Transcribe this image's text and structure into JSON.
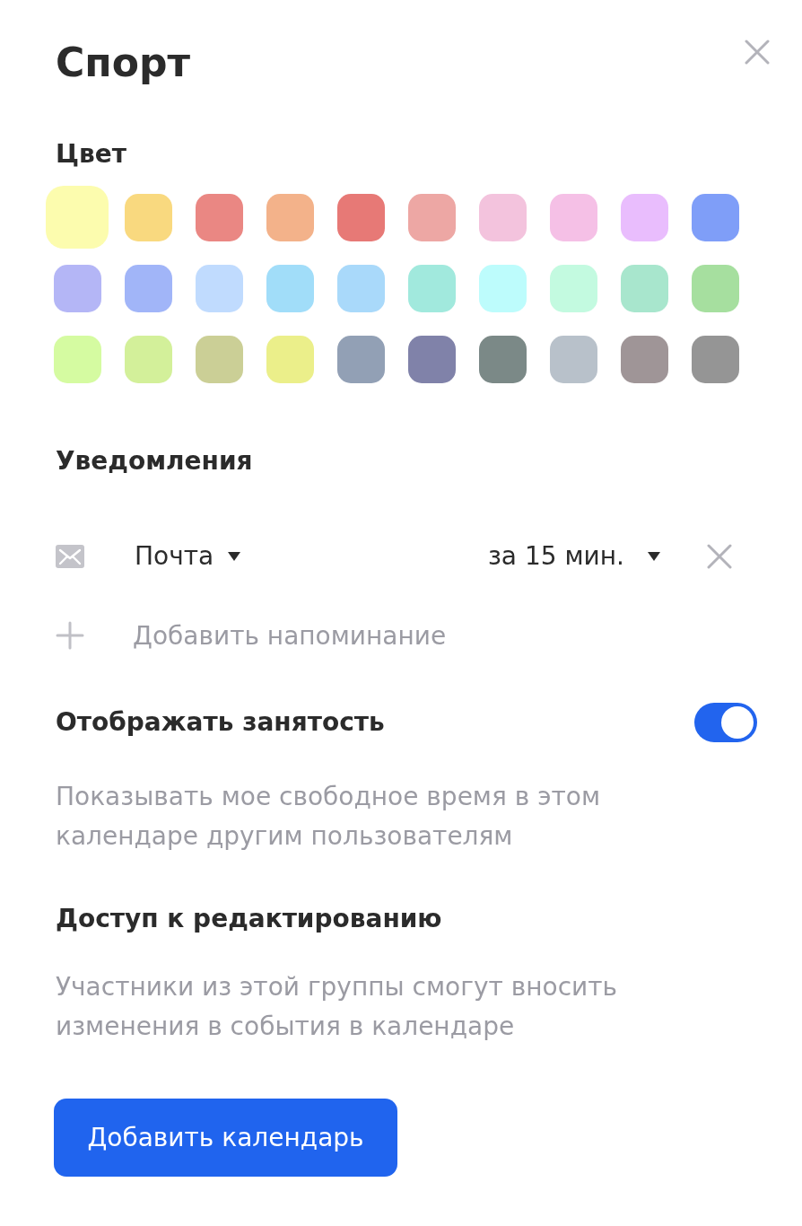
{
  "title": "Спорт",
  "colors": {
    "heading": "Цвет",
    "swatches": [
      {
        "color": "#fcfcae",
        "selected": true
      },
      {
        "color": "#f9d97f",
        "selected": false
      },
      {
        "color": "#ea8783",
        "selected": false
      },
      {
        "color": "#f3b28a",
        "selected": false
      },
      {
        "color": "#e77976",
        "selected": false
      },
      {
        "color": "#eda7a4",
        "selected": false
      },
      {
        "color": "#f3c3dd",
        "selected": false
      },
      {
        "color": "#f5c0e6",
        "selected": false
      },
      {
        "color": "#e9bdfd",
        "selected": false
      },
      {
        "color": "#7f9ef8",
        "selected": false
      },
      {
        "color": "#b4b6f6",
        "selected": false
      },
      {
        "color": "#a1b5f8",
        "selected": false
      },
      {
        "color": "#c0dbfe",
        "selected": false
      },
      {
        "color": "#a1ddf9",
        "selected": false
      },
      {
        "color": "#a9d9fa",
        "selected": false
      },
      {
        "color": "#a1e9dd",
        "selected": false
      },
      {
        "color": "#bdfcfc",
        "selected": false
      },
      {
        "color": "#c3fae0",
        "selected": false
      },
      {
        "color": "#a8e6cd",
        "selected": false
      },
      {
        "color": "#a6df9f",
        "selected": false
      },
      {
        "color": "#d5fba1",
        "selected": false
      },
      {
        "color": "#d3f09a",
        "selected": false
      },
      {
        "color": "#cbcf96",
        "selected": false
      },
      {
        "color": "#ebef8a",
        "selected": false
      },
      {
        "color": "#92a0b5",
        "selected": false
      },
      {
        "color": "#8082a9",
        "selected": false
      },
      {
        "color": "#7b8987",
        "selected": false
      },
      {
        "color": "#b8c1ca",
        "selected": false
      },
      {
        "color": "#9f9597",
        "selected": false
      },
      {
        "color": "#959595",
        "selected": false
      }
    ]
  },
  "notifications": {
    "heading": "Уведомления",
    "items": [
      {
        "kind": "email",
        "channel": "Почта",
        "time": "за 15 мин."
      }
    ],
    "add_label": "Добавить напоминание"
  },
  "busy_visibility": {
    "heading": "Отображать занятость",
    "on": true,
    "description": "Показывать мое свободное время в этом календаре другим пользователям"
  },
  "edit_access": {
    "heading": "Доступ к редактированию",
    "description": "Участники из этой группы смогут вносить изменения в события в календаре"
  },
  "submit_button": "Добавить календарь"
}
